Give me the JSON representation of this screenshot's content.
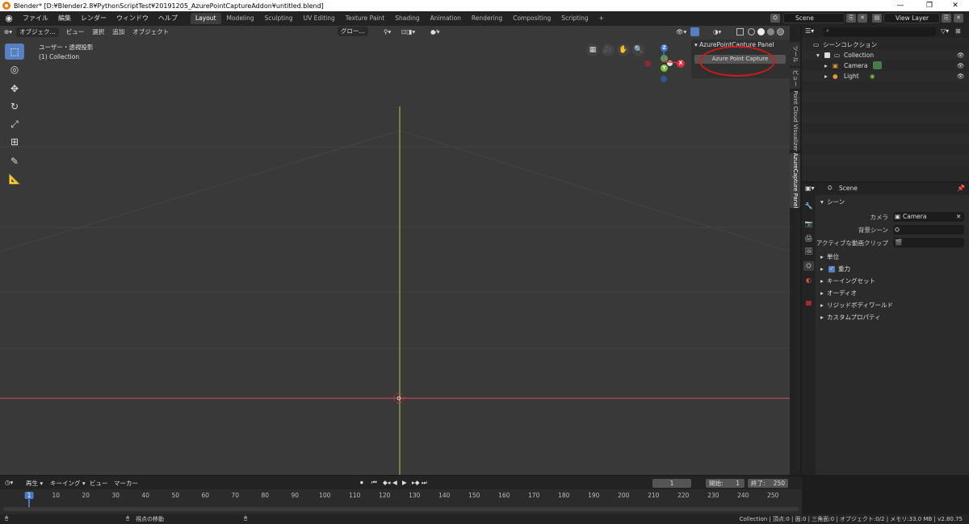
{
  "titlebar": {
    "title": "Blender* [D:¥Blender2.8¥PythonScriptTest¥20191205_AzurePointCaptureAddon¥untitled.blend]",
    "minimize": "—",
    "maximize": "❐",
    "close": "✕"
  },
  "menubar": {
    "items": [
      "ファイル",
      "編集",
      "レンダー",
      "ウィンドウ",
      "ヘルプ"
    ],
    "tabs": [
      "Layout",
      "Modeling",
      "Sculpting",
      "UV Editing",
      "Texture Paint",
      "Shading",
      "Animation",
      "Rendering",
      "Compositing",
      "Scripting"
    ],
    "add_tab": "+",
    "scene_label": "Scene",
    "view_layer_label": "View Layer"
  },
  "viewport": {
    "mode": "オブジェク...",
    "menus": [
      "ビュー",
      "選択",
      "追加",
      "オブジェクト"
    ],
    "transform": "グロー...",
    "view_name": "ユーザー・透視投影",
    "collection": "(1) Collection"
  },
  "gizmo": {
    "z": "Z",
    "y": "Y",
    "x": "X"
  },
  "npanel": {
    "title": "AzurePointCapture Panel",
    "button": "Azure Point Capture"
  },
  "vtabs": [
    "ツール",
    "ビュー",
    "Point Cloud Visualizer",
    "AzureCapture Panel"
  ],
  "outliner": {
    "root": "シーンコレクション",
    "collection": "Collection",
    "items": [
      "Camera",
      "Light"
    ]
  },
  "properties": {
    "scene_name": "Scene",
    "section": "シーン",
    "camera_label": "カメラ",
    "camera_value": "Camera",
    "bg_scene_label": "背景シーン",
    "clip_label": "アクティブな動画クリップ",
    "subsections": [
      "単位",
      "重力",
      "キーイングセット",
      "オーディオ",
      "リジッドボディワールド",
      "カスタムプロパティ"
    ]
  },
  "timeline": {
    "menus": [
      "再生",
      "キーイング",
      "ビュー",
      "マーカー"
    ],
    "current_frame": "1",
    "start_label": "開始:",
    "start_value": "1",
    "end_label": "終了:",
    "end_value": "250",
    "ticks": [
      "1",
      "10",
      "20",
      "30",
      "40",
      "50",
      "60",
      "70",
      "80",
      "90",
      "100",
      "110",
      "120",
      "130",
      "140",
      "150",
      "160",
      "170",
      "180",
      "190",
      "200",
      "210",
      "220",
      "230",
      "240",
      "250"
    ]
  },
  "statusbar": {
    "hint": "視点の移動",
    "stats": "Collection | 頂点:0 | 面:0 | 三角面:0 | オブジェクト:0/2 | メモリ:33.0 MB | v2.80.75"
  }
}
